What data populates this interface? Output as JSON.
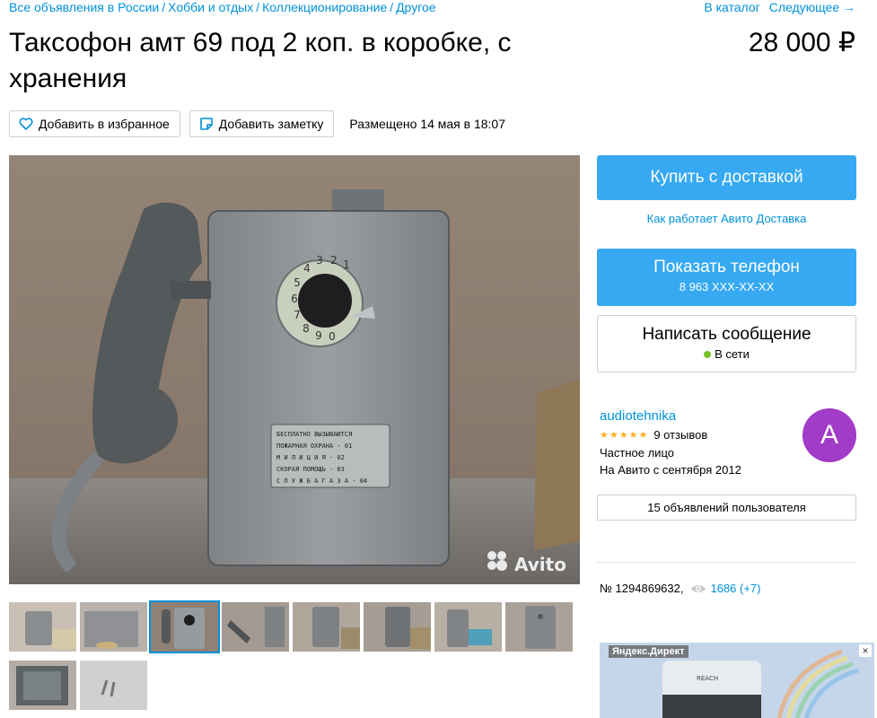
{
  "breadcrumbs": [
    "Все объявления в России",
    "Хобби и отдых",
    "Коллекционирование",
    "Другое"
  ],
  "nav": {
    "catalog": "В каталог",
    "next": "Следующее →"
  },
  "listing": {
    "title": "Таксофон амт 69 под 2 коп. в коробке, с хранения",
    "price": "28 000 ₽",
    "posted": "Размещено 14 мая в 18:07",
    "id_text": "№ 1294869632,",
    "views": "1686 (+7)"
  },
  "actions": {
    "favorite": "Добавить в избранное",
    "note": "Добавить заметку"
  },
  "photo": {
    "watermark": "Avito",
    "dial_digits": [
      "1",
      "2",
      "3",
      "4",
      "5",
      "6",
      "7",
      "8",
      "9",
      "0"
    ],
    "plate_lines": [
      "БЕСПЛАТНО ВЫЗЫВАЮТСЯ",
      "ПОЖАРНАЯ ОХРАНА - 01",
      "М И Л И Ц И Я  - 02",
      "СКОРАЯ ПОМОЩЬ - 03",
      "С Л У Ж Б А  Г А З А - 04"
    ]
  },
  "thumbnails_count": 10,
  "sidebar": {
    "buy": "Купить с доставкой",
    "delivery_link": "Как работает Авито Доставка",
    "phone": "Показать телефон",
    "phone_number": "8 963 XXX-XX-XX",
    "message": "Написать сообщение",
    "online": "В сети"
  },
  "seller": {
    "name": "audiotehnika",
    "stars": "★★★★★",
    "reviews": "9 отзывов",
    "type": "Частное лицо",
    "since": "На Авито с сентября 2012",
    "avatar_letter": "A",
    "ads_button": "15 объявлений пользователя"
  },
  "ad": {
    "label": "Яндекс.Директ",
    "close": "×",
    "product_badge": "REACH"
  },
  "colors": {
    "link": "#0091d9",
    "button": "#36a9f2",
    "avatar": "#a23bc7",
    "online": "#77c226",
    "stars": "#ffb021"
  }
}
